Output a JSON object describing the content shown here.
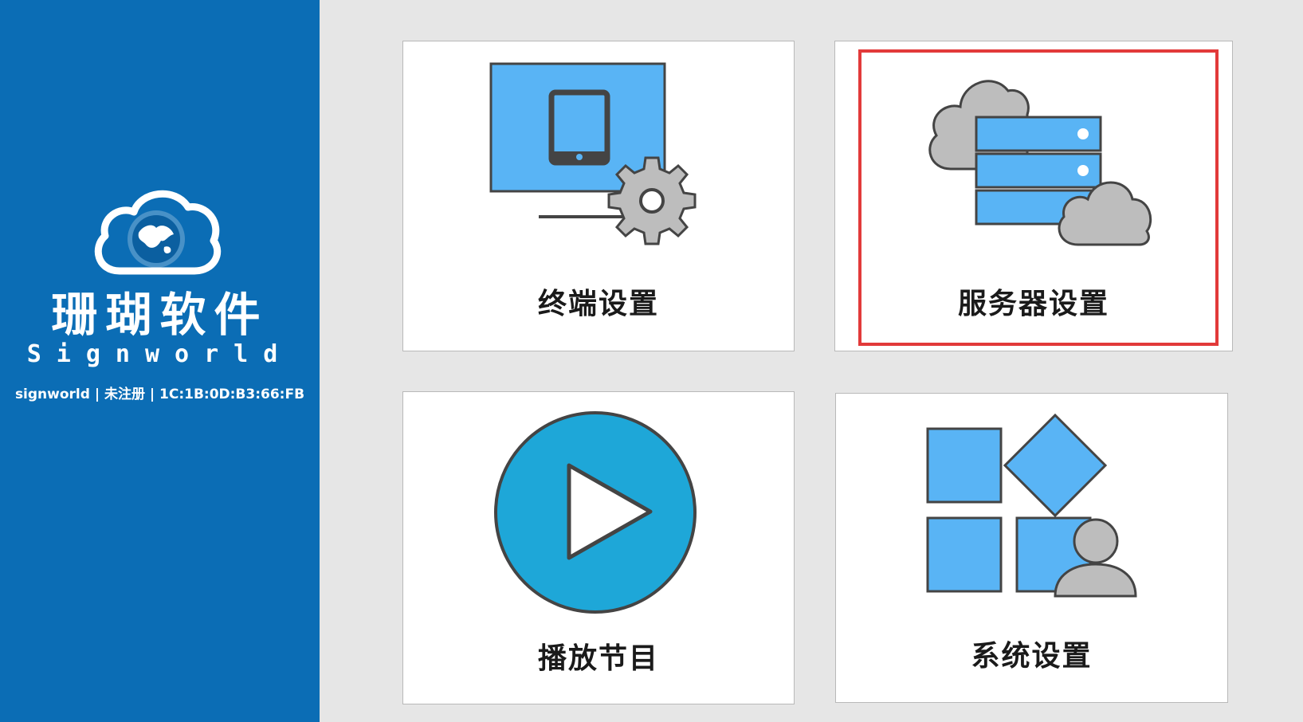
{
  "brand": {
    "name_cn": "珊瑚软件",
    "name_en": "Signworld",
    "status_line": "signworld | 未注册 | 1C:1B:0D:B3:66:FB"
  },
  "menu": {
    "tiles": [
      {
        "label": "终端设置",
        "icon": "monitor-tablet-gear-icon"
      },
      {
        "label": "服务器设置",
        "icon": "server-cloud-icon"
      },
      {
        "label": "播放节目",
        "icon": "play-circle-icon"
      },
      {
        "label": "系统设置",
        "icon": "app-grid-user-icon"
      }
    ],
    "selected_index": 1
  },
  "colors": {
    "sidebar": "#0b6db5",
    "icon_blue": "#59b4f5",
    "play_blue": "#1ea7d8",
    "cloud_gray": "#bdbdbd",
    "highlight_red": "#e23a3a"
  }
}
